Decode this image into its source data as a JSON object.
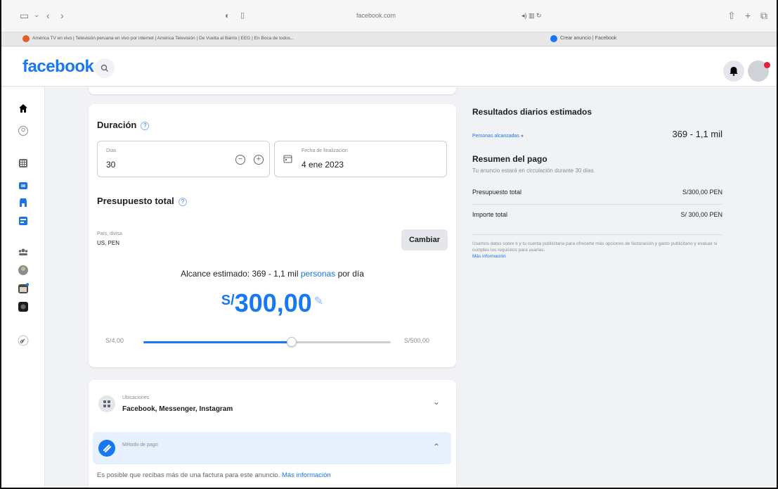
{
  "browser": {
    "url": "facebook.com",
    "tabs": [
      {
        "title": "América TV en vivo | Televisión peruana en vivo por internet | América Televisión | De Vuelta al Barrio | EEG | En Boca de todos..."
      },
      {
        "title": "Crear anuncio | Facebook"
      }
    ]
  },
  "header": {
    "logo": "facebook"
  },
  "duration": {
    "title": "Duración",
    "days_label": "Días",
    "days_value": "30",
    "end_label": "Fecha de finalización",
    "end_value": "4 ene 2023"
  },
  "budget": {
    "title": "Presupuesto total",
    "country_label": "País, divisa",
    "country_value": "US, PEN",
    "change_button": "Cambiar",
    "reach_prefix": "Alcance estimado: 369 - 1,1 mil",
    "reach_link": "personas",
    "reach_suffix": "por día",
    "currency_symbol": "S/",
    "amount": "300,00",
    "slider_min": "S/4,00",
    "slider_max": "S/500,00",
    "slider_fraction": 0.6
  },
  "placements": {
    "label": "Ubicaciones",
    "value": "Facebook, Messenger, Instagram"
  },
  "payment": {
    "label": "Método de pago",
    "note": "Es posible que recibas más de una factura para este anuncio.",
    "note_link": "Más información"
  },
  "results": {
    "title": "Resultados diarios estimados",
    "people_label": "Personas alcanzadas",
    "people_value": "369 - 1,1 mil",
    "summary_title": "Resumen del pago",
    "summary_sub": "Tu anuncio estará en circulación durante 30 días.",
    "budget_label": "Presupuesto total",
    "budget_value": "S/300,00 PEN",
    "total_label": "Importe total",
    "total_value": "S/ 300,00 PEN",
    "fine_print": "Usamos datos sobre ti y tu cuenta publicitaria para ofrecerte más opciones de facturación y gasto publicitario y evaluar si cumples los requisitos para usarlas.",
    "fine_link": "Más información"
  },
  "colors": {
    "brand": "#1877f2"
  }
}
